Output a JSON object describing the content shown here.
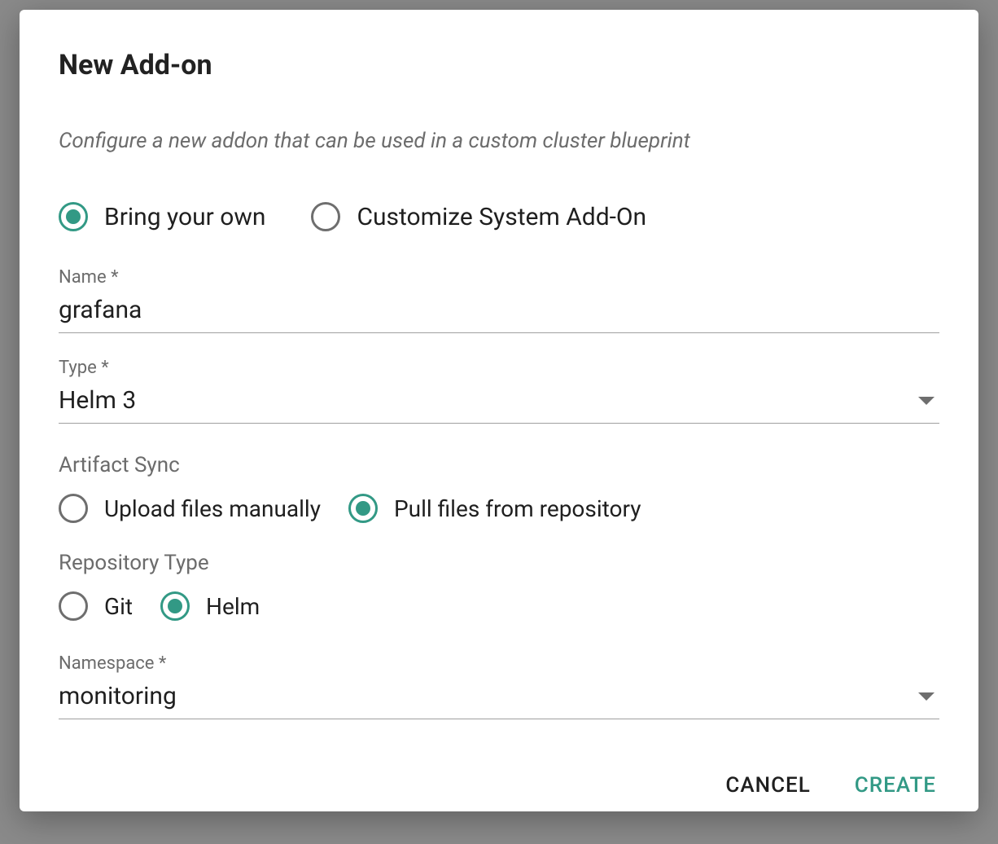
{
  "modal": {
    "title": "New Add-on",
    "subtitle": "Configure a new addon that can be used in a custom cluster blueprint"
  },
  "source_type": {
    "options": [
      {
        "label": "Bring your own",
        "selected": true
      },
      {
        "label": "Customize System Add-On",
        "selected": false
      }
    ]
  },
  "fields": {
    "name": {
      "label": "Name *",
      "value": "grafana"
    },
    "type": {
      "label": "Type *",
      "value": "Helm 3"
    },
    "namespace": {
      "label": "Namespace *",
      "value": "monitoring"
    }
  },
  "artifact_sync": {
    "label": "Artifact Sync",
    "options": [
      {
        "label": "Upload files manually",
        "selected": false
      },
      {
        "label": "Pull files from repository",
        "selected": true
      }
    ]
  },
  "repo_type": {
    "label": "Repository Type",
    "options": [
      {
        "label": "Git",
        "selected": false
      },
      {
        "label": "Helm",
        "selected": true
      }
    ]
  },
  "actions": {
    "cancel": "CANCEL",
    "create": "CREATE"
  }
}
